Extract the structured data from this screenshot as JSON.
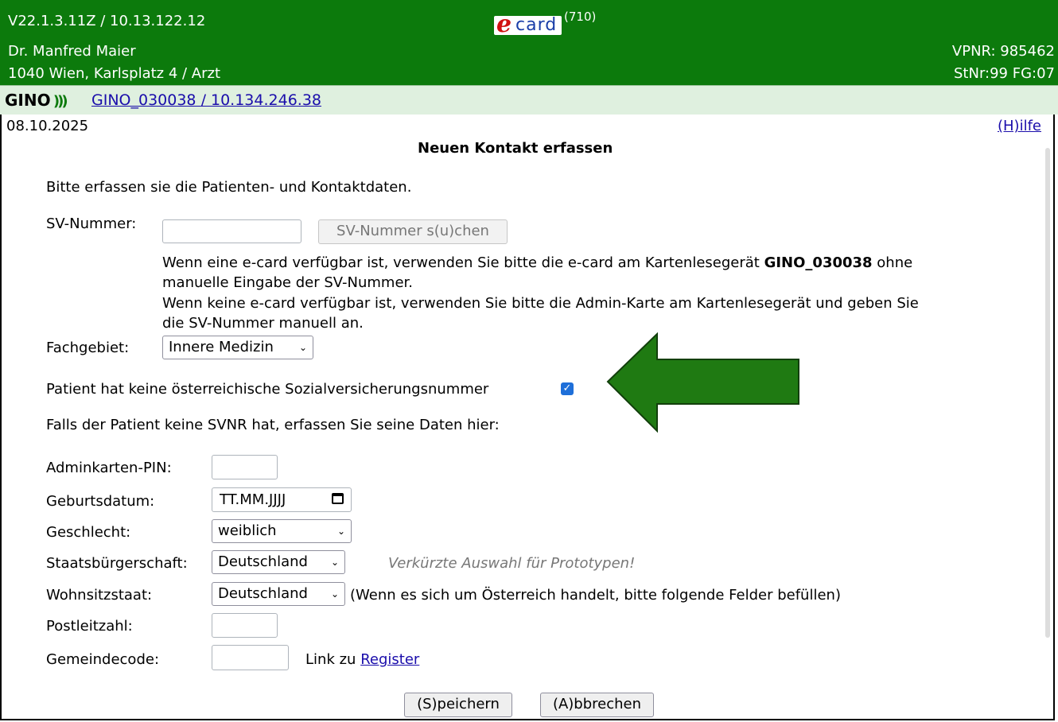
{
  "header": {
    "version": "V22.1.3.11Z / 10.13.122.12",
    "doctor": "Dr. Manfred Maier",
    "address": "1040 Wien, Karlsplatz 4 / Arzt",
    "vpnr": "VPNR: 985462",
    "stnr": "StNr:99 FG:07",
    "logo_e": "e",
    "logo_card": "card",
    "logo_count": "(710)",
    "accent_color": "#0c7a0c"
  },
  "gino": {
    "logo": "GINO",
    "link": "GINO_030038 / 10.134.246.38"
  },
  "page": {
    "date": "08.10.2025",
    "help_link": "(H)ilfe",
    "title": "Neuen Kontakt erfassen",
    "intro": "Bitte erfassen sie die Patienten- und Kontaktdaten."
  },
  "sv": {
    "label": "SV-Nummer:",
    "value": "",
    "search_button": "SV-Nummer s(u)chen",
    "info_line1_a": "Wenn eine e-card verfügbar ist, verwenden Sie bitte die e-card am Kartenlesegerät ",
    "info_line1_b": "GINO_030038",
    "info_line1_c": " ohne",
    "info_line2": "manuelle Eingabe der SV-Nummer.",
    "info_line3": "Wenn keine e-card verfügbar ist, verwenden Sie bitte die Admin-Karte am Kartenlesegerät und geben Sie",
    "info_line4": "die SV-Nummer manuell an."
  },
  "fachgebiet": {
    "label": "Fachgebiet:",
    "selected": "Innere Medizin"
  },
  "no_svnr": {
    "label": "Patient hat keine österreichische Sozialversicherungsnummer",
    "checked": true
  },
  "no_svnr_hint": "Falls der Patient keine SVNR hat, erfassen Sie seine Daten hier:",
  "form": {
    "pin_label": "Adminkarten-PIN:",
    "birth_label": "Geburtsdatum:",
    "birth_placeholder": "TT.MM.JJJJ",
    "gender_label": "Geschlecht:",
    "gender_selected": "weiblich",
    "citizenship_label": "Staatsbürgerschaft:",
    "citizenship_selected": "Deutschland",
    "citizenship_hint": "Verkürzte Auswahl für Prototypen!",
    "residence_label": "Wohnsitzstaat:",
    "residence_selected": "Deutschland",
    "residence_hint": "(Wenn es sich um Österreich handelt, bitte folgende Felder befüllen)",
    "zip_label": "Postleitzahl:",
    "municipality_label": "Gemeindecode:",
    "register_prefix": "Link zu",
    "register_link": "Register"
  },
  "actions": {
    "save": "(S)peichern",
    "cancel": "(A)bbrechen"
  },
  "annotation": {
    "arrow_color": "#1f7a12",
    "arrow_direction": "left"
  }
}
